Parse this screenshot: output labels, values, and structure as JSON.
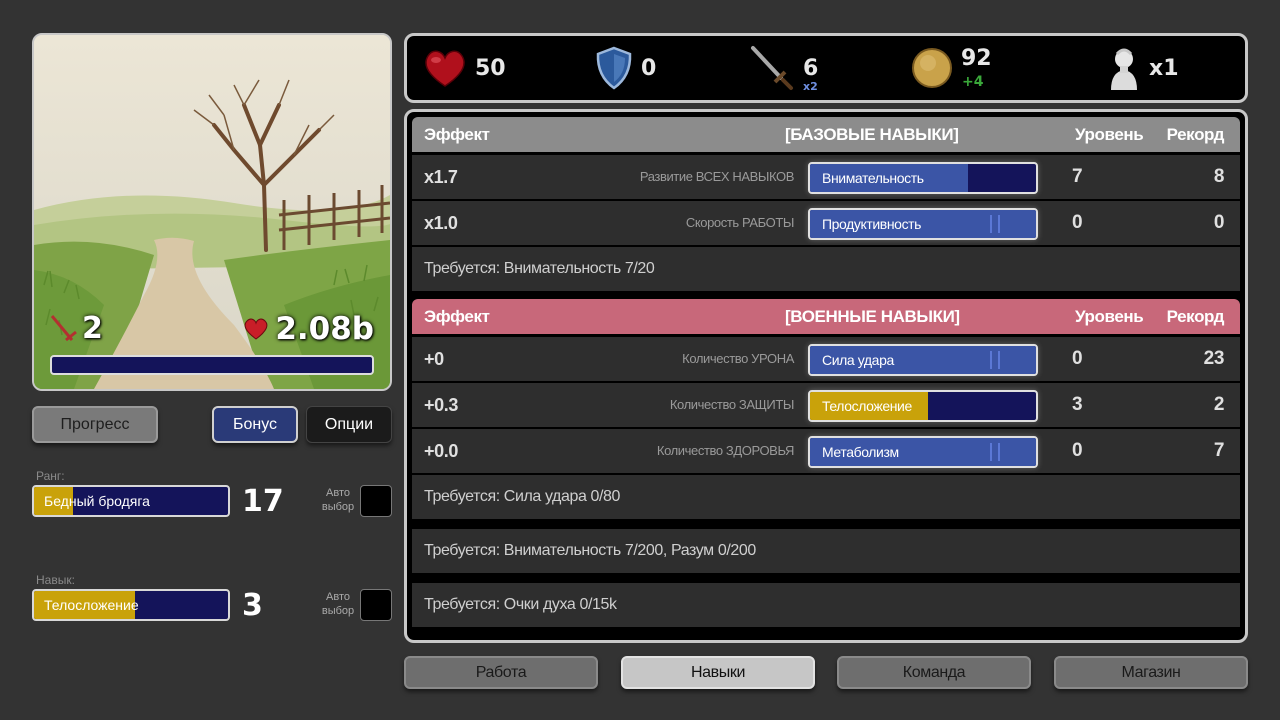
{
  "picture": {
    "weapon_count": "2",
    "hp_value": "2.08b",
    "progress": 0.0
  },
  "buttons": {
    "progress": "Прогресс",
    "bonus": "Бонус",
    "options": "Опции"
  },
  "rank": {
    "label": "Ранг:",
    "name": "Бедный бродяга",
    "fill": 0.2,
    "level": "17",
    "auto_label": "Авто выбор"
  },
  "skill": {
    "label": "Навык:",
    "name": "Телосложение",
    "fill": 0.52,
    "level": "3",
    "auto_label": "Авто выбор"
  },
  "stats": {
    "health": "50",
    "armor": "0",
    "attack": "6",
    "attack_mult": "x2",
    "coins": "92",
    "coins_delta": "+4",
    "bust_mult": "x1"
  },
  "base_skills": {
    "header": {
      "effect": "Эффект",
      "title": "[БАЗОВЫЕ НАВЫКИ]",
      "level": "Уровень",
      "record": "Рекорд"
    },
    "rows": [
      {
        "effect": "x1.7",
        "desc": "Развитие ВСЕХ НАВЫКОВ",
        "name": "Внимательность",
        "fill": 0.7,
        "level": "7",
        "record": "8"
      },
      {
        "effect": "x1.0",
        "desc": "Скорость РАБОТЫ",
        "name": "Продуктивность",
        "fill": 1.0,
        "level": "0",
        "record": "0"
      }
    ],
    "requirement": "Требуется:  Внимательность 7/20"
  },
  "military_skills": {
    "header": {
      "effect": "Эффект",
      "title": "[ВОЕННЫЕ НАВЫКИ]",
      "level": "Уровень",
      "record": "Рекорд"
    },
    "rows": [
      {
        "effect": "+0",
        "desc": "Количество УРОНА",
        "name": "Сила удара",
        "fill": 1.0,
        "level": "0",
        "record": "23"
      },
      {
        "effect": "+0.3",
        "desc": "Количество ЗАЩИТЫ",
        "name": "Телосложение",
        "fill": 0.52,
        "level": "3",
        "record": "2"
      },
      {
        "effect": "+0.0",
        "desc": "Количество ЗДОРОВЬЯ",
        "name": "Метаболизм",
        "fill": 1.0,
        "level": "0",
        "record": "7"
      }
    ],
    "requirement": "Требуется:  Сила удара 0/80"
  },
  "requirements_extra": [
    "Требуется:  Внимательность 7/200,  Разум 0/200",
    "Требуется:  Очки духа 0/15k"
  ],
  "nav": {
    "work": "Работа",
    "skills": "Навыки",
    "team": "Команда",
    "shop": "Магазин"
  },
  "colors": {
    "bar_blue": "#3b55a6",
    "bar_gold": "#c9a20a",
    "bar_empty": "#14145a",
    "military_header": "#c8687a",
    "base_header": "#8c8c8c"
  }
}
